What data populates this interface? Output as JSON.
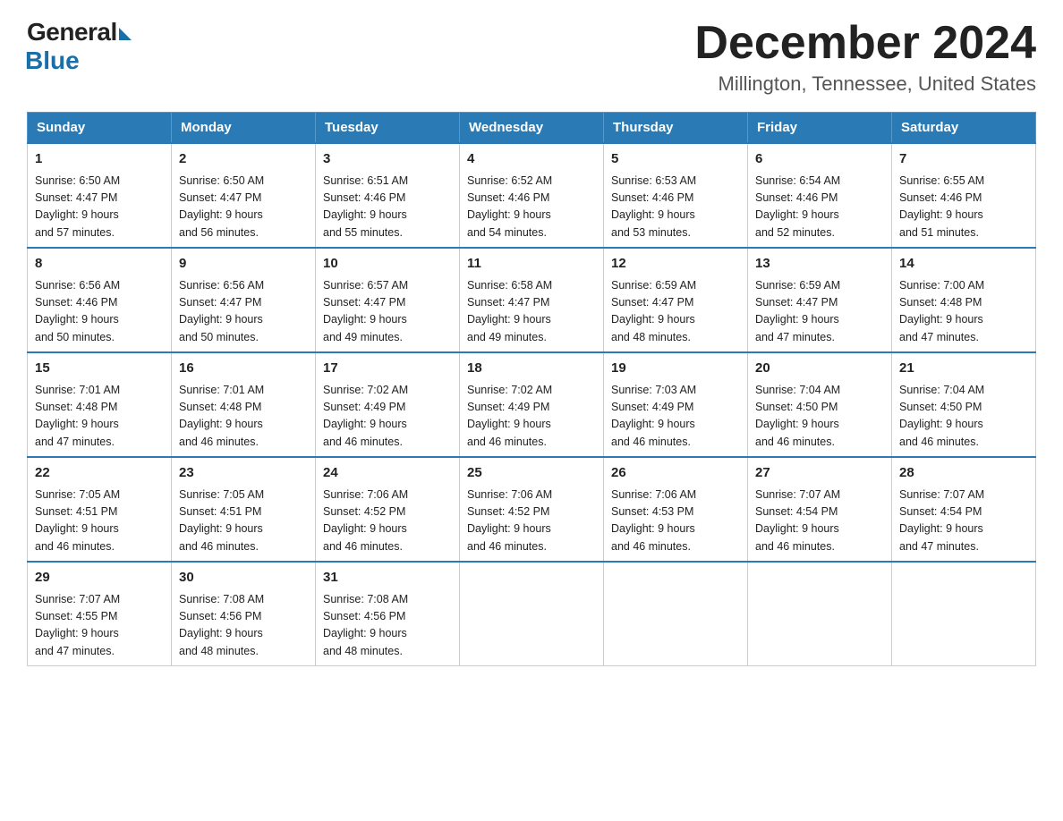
{
  "header": {
    "logo": {
      "general": "General",
      "blue": "Blue"
    },
    "title": "December 2024",
    "location": "Millington, Tennessee, United States"
  },
  "days_of_week": [
    "Sunday",
    "Monday",
    "Tuesday",
    "Wednesday",
    "Thursday",
    "Friday",
    "Saturday"
  ],
  "weeks": [
    [
      {
        "day": "1",
        "sunrise": "6:50 AM",
        "sunset": "4:47 PM",
        "daylight": "9 hours and 57 minutes."
      },
      {
        "day": "2",
        "sunrise": "6:50 AM",
        "sunset": "4:47 PM",
        "daylight": "9 hours and 56 minutes."
      },
      {
        "day": "3",
        "sunrise": "6:51 AM",
        "sunset": "4:46 PM",
        "daylight": "9 hours and 55 minutes."
      },
      {
        "day": "4",
        "sunrise": "6:52 AM",
        "sunset": "4:46 PM",
        "daylight": "9 hours and 54 minutes."
      },
      {
        "day": "5",
        "sunrise": "6:53 AM",
        "sunset": "4:46 PM",
        "daylight": "9 hours and 53 minutes."
      },
      {
        "day": "6",
        "sunrise": "6:54 AM",
        "sunset": "4:46 PM",
        "daylight": "9 hours and 52 minutes."
      },
      {
        "day": "7",
        "sunrise": "6:55 AM",
        "sunset": "4:46 PM",
        "daylight": "9 hours and 51 minutes."
      }
    ],
    [
      {
        "day": "8",
        "sunrise": "6:56 AM",
        "sunset": "4:46 PM",
        "daylight": "9 hours and 50 minutes."
      },
      {
        "day": "9",
        "sunrise": "6:56 AM",
        "sunset": "4:47 PM",
        "daylight": "9 hours and 50 minutes."
      },
      {
        "day": "10",
        "sunrise": "6:57 AM",
        "sunset": "4:47 PM",
        "daylight": "9 hours and 49 minutes."
      },
      {
        "day": "11",
        "sunrise": "6:58 AM",
        "sunset": "4:47 PM",
        "daylight": "9 hours and 49 minutes."
      },
      {
        "day": "12",
        "sunrise": "6:59 AM",
        "sunset": "4:47 PM",
        "daylight": "9 hours and 48 minutes."
      },
      {
        "day": "13",
        "sunrise": "6:59 AM",
        "sunset": "4:47 PM",
        "daylight": "9 hours and 47 minutes."
      },
      {
        "day": "14",
        "sunrise": "7:00 AM",
        "sunset": "4:48 PM",
        "daylight": "9 hours and 47 minutes."
      }
    ],
    [
      {
        "day": "15",
        "sunrise": "7:01 AM",
        "sunset": "4:48 PM",
        "daylight": "9 hours and 47 minutes."
      },
      {
        "day": "16",
        "sunrise": "7:01 AM",
        "sunset": "4:48 PM",
        "daylight": "9 hours and 46 minutes."
      },
      {
        "day": "17",
        "sunrise": "7:02 AM",
        "sunset": "4:49 PM",
        "daylight": "9 hours and 46 minutes."
      },
      {
        "day": "18",
        "sunrise": "7:02 AM",
        "sunset": "4:49 PM",
        "daylight": "9 hours and 46 minutes."
      },
      {
        "day": "19",
        "sunrise": "7:03 AM",
        "sunset": "4:49 PM",
        "daylight": "9 hours and 46 minutes."
      },
      {
        "day": "20",
        "sunrise": "7:04 AM",
        "sunset": "4:50 PM",
        "daylight": "9 hours and 46 minutes."
      },
      {
        "day": "21",
        "sunrise": "7:04 AM",
        "sunset": "4:50 PM",
        "daylight": "9 hours and 46 minutes."
      }
    ],
    [
      {
        "day": "22",
        "sunrise": "7:05 AM",
        "sunset": "4:51 PM",
        "daylight": "9 hours and 46 minutes."
      },
      {
        "day": "23",
        "sunrise": "7:05 AM",
        "sunset": "4:51 PM",
        "daylight": "9 hours and 46 minutes."
      },
      {
        "day": "24",
        "sunrise": "7:06 AM",
        "sunset": "4:52 PM",
        "daylight": "9 hours and 46 minutes."
      },
      {
        "day": "25",
        "sunrise": "7:06 AM",
        "sunset": "4:52 PM",
        "daylight": "9 hours and 46 minutes."
      },
      {
        "day": "26",
        "sunrise": "7:06 AM",
        "sunset": "4:53 PM",
        "daylight": "9 hours and 46 minutes."
      },
      {
        "day": "27",
        "sunrise": "7:07 AM",
        "sunset": "4:54 PM",
        "daylight": "9 hours and 46 minutes."
      },
      {
        "day": "28",
        "sunrise": "7:07 AM",
        "sunset": "4:54 PM",
        "daylight": "9 hours and 47 minutes."
      }
    ],
    [
      {
        "day": "29",
        "sunrise": "7:07 AM",
        "sunset": "4:55 PM",
        "daylight": "9 hours and 47 minutes."
      },
      {
        "day": "30",
        "sunrise": "7:08 AM",
        "sunset": "4:56 PM",
        "daylight": "9 hours and 48 minutes."
      },
      {
        "day": "31",
        "sunrise": "7:08 AM",
        "sunset": "4:56 PM",
        "daylight": "9 hours and 48 minutes."
      },
      null,
      null,
      null,
      null
    ]
  ],
  "labels": {
    "sunrise": "Sunrise:",
    "sunset": "Sunset:",
    "daylight": "Daylight:"
  }
}
